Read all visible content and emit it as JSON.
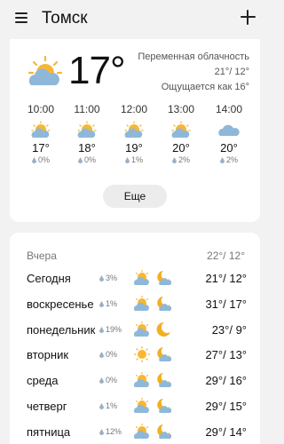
{
  "header": {
    "city": "Томск"
  },
  "current": {
    "temp": "17°",
    "condition": "Переменная облачность",
    "hi_lo": "21°/ 12°",
    "feels_like": "Ощущается как 16°",
    "icon": "partly-cloudy-icon"
  },
  "hourly": [
    {
      "time": "10:00",
      "temp": "17°",
      "precip": "0%",
      "icon": "partly-cloudy-icon"
    },
    {
      "time": "11:00",
      "temp": "18°",
      "precip": "0%",
      "icon": "partly-cloudy-icon"
    },
    {
      "time": "12:00",
      "temp": "19°",
      "precip": "1%",
      "icon": "partly-cloudy-icon"
    },
    {
      "time": "13:00",
      "temp": "20°",
      "precip": "2%",
      "icon": "partly-cloudy-icon"
    },
    {
      "time": "14:00",
      "temp": "20°",
      "precip": "2%",
      "icon": "cloud-icon"
    }
  ],
  "more_label": "Еще",
  "yesterday": {
    "label": "Вчера",
    "temps": "22°/ 12°"
  },
  "daily": [
    {
      "day": "Сегодня",
      "precip": "3%",
      "day_icon": "partly-cloudy-icon",
      "night_icon": "partly-cloudy-night-icon",
      "temps": "21°/ 12°"
    },
    {
      "day": "воскресенье",
      "precip": "1%",
      "day_icon": "partly-cloudy-icon",
      "night_icon": "partly-cloudy-night-icon",
      "temps": "31°/ 17°"
    },
    {
      "day": "понедельник",
      "precip": "19%",
      "day_icon": "partly-cloudy-icon",
      "night_icon": "moon-icon",
      "temps": "23°/ 9°"
    },
    {
      "day": "вторник",
      "precip": "0%",
      "day_icon": "sun-icon",
      "night_icon": "partly-cloudy-night-icon",
      "temps": "27°/ 13°"
    },
    {
      "day": "среда",
      "precip": "0%",
      "day_icon": "partly-cloudy-icon",
      "night_icon": "partly-cloudy-night-icon",
      "temps": "29°/ 16°"
    },
    {
      "day": "четверг",
      "precip": "1%",
      "day_icon": "partly-cloudy-icon",
      "night_icon": "partly-cloudy-night-icon",
      "temps": "29°/ 15°"
    },
    {
      "day": "пятница",
      "precip": "12%",
      "day_icon": "partly-cloudy-icon",
      "night_icon": "partly-cloudy-night-icon",
      "temps": "29°/ 14°"
    }
  ],
  "colors": {
    "sun": "#f7b733",
    "cloud": "#8fb8d8",
    "moon": "#f2b01e",
    "drop": "#9ab0c4"
  }
}
